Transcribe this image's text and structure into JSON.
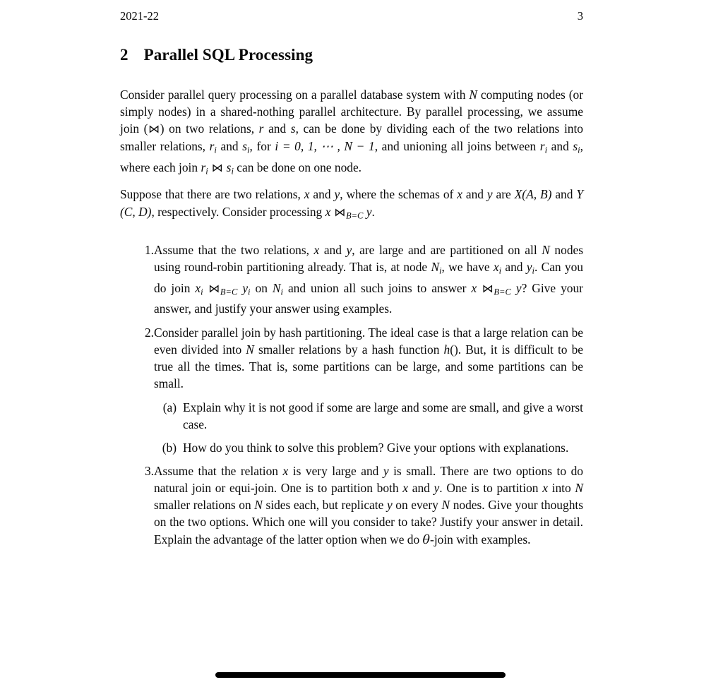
{
  "header": {
    "left": "2021-22",
    "page_number": "3"
  },
  "section": {
    "number": "2",
    "title": "Parallel SQL Processing"
  },
  "paragraphs": {
    "p1_part1": "Consider parallel query processing on a parallel database system with ",
    "p1_var_N1": "N",
    "p1_part2": " computing nodes (or simply nodes) in a shared-nothing parallel architecture. By parallel processing, we assume join (",
    "p1_bowtie1": "⋈",
    "p1_part3": ") on two relations, ",
    "p1_var_r1": "r",
    "p1_part4": " and ",
    "p1_var_s1": "s",
    "p1_part5": ", can be done by dividing each of the two relations into smaller relations, ",
    "p1_var_ri1": "r",
    "p1_sub_i1": "i",
    "p1_part6": " and ",
    "p1_var_si1": "s",
    "p1_sub_i2": "i",
    "p1_part7": ", for ",
    "p1_math_range": "i = 0, 1, ⋯ , N − 1",
    "p1_part8": ", and unioning all joins between ",
    "p1_var_ri2": "r",
    "p1_sub_i3": "i",
    "p1_part9": " and ",
    "p1_var_si2": "s",
    "p1_sub_i4": "i",
    "p1_part10": ", where each join ",
    "p1_var_ri3": "r",
    "p1_sub_i5": "i",
    "p1_bowtie2": "⋈",
    "p1_var_si3": "s",
    "p1_sub_i6": "i",
    "p1_part11": " can be done on one node.",
    "p2_part1": "Suppose that there are two relations, ",
    "p2_var_x1": "x",
    "p2_part2": " and ",
    "p2_var_y1": "y",
    "p2_part3": ", where the schemas of ",
    "p2_var_x2": "x",
    "p2_part4": " and ",
    "p2_var_y2": "y",
    "p2_part5": " are ",
    "p2_schema_X": "X(A, B)",
    "p2_part6": " and ",
    "p2_schema_Y": "Y (C, D)",
    "p2_part7": ", respectively. Consider processing ",
    "p2_var_x3": "x",
    "p2_bowtie": "⋈",
    "p2_sub_bc": "B=C",
    "p2_var_y3": "y",
    "p2_part8": "."
  },
  "items": {
    "item1": {
      "marker": "1.",
      "t1": "Assume that the two relations, ",
      "v_x1": "x",
      "t2": " and ",
      "v_y1": "y",
      "t3": ", are large and are partitioned on all ",
      "v_N1": "N",
      "t4": " nodes using round-robin partitioning already. That is, at node ",
      "v_N2": "N",
      "s_i1": "i",
      "t5": ", we have ",
      "v_x2": "x",
      "s_i2": "i",
      "t6": " and ",
      "v_y2": "y",
      "s_i3": "i",
      "t7": ". Can you do join ",
      "v_x3": "x",
      "s_i4": "i",
      "bowtie1": "⋈",
      "sub_bc1": "B=C",
      "v_y3": "y",
      "s_i5": "i",
      "t8": " on ",
      "v_N3": "N",
      "s_i6": "i",
      "t9": " and union all such joins to answer ",
      "v_x4": "x",
      "bowtie2": "⋈",
      "sub_bc2": "B=C",
      "v_y4": "y",
      "t10": "? Give your answer, and justify your answer using examples."
    },
    "item2": {
      "marker": "2.",
      "t1": "Consider parallel join by hash partitioning. The ideal case is that a large relation can be even divided into ",
      "v_N1": "N",
      "t2": " smaller relations by a hash function ",
      "v_h": "h",
      "t3": "(). But, it is difficult to be true all the times. That is, some partitions can be large, and some partitions can be small.",
      "sub": {
        "a": {
          "marker": "(a)",
          "text": "Explain why it is not good if some are large and some are small, and give a worst case."
        },
        "b": {
          "marker": "(b)",
          "text": "How do you think to solve this problem? Give your options with explanations."
        }
      }
    },
    "item3": {
      "marker": "3.",
      "t1": "Assume that the relation ",
      "v_x1": "x",
      "t2": " is very large and ",
      "v_y1": "y",
      "t3": " is small. There are two options to do natural join or equi-join. One is to partition both ",
      "v_x2": "x",
      "t4": " and ",
      "v_y2": "y",
      "t5": ". One is to partition ",
      "v_x3": "x",
      "t6": " into ",
      "v_N1": "N",
      "t7": " smaller relations on ",
      "v_N2": "N",
      "t8": " sides each, but replicate ",
      "v_y3": "y",
      "t9": " on every ",
      "v_N3": "N",
      "t10": " nodes. Give your thoughts on the two options. Which one will you consider to take? Justify your answer in detail. Explain the advantage of the latter option when we do ",
      "v_theta": "θ",
      "t11": "-join with examples."
    }
  },
  "colors": {
    "page_background": "#ffffff",
    "text": "#0a0a0a",
    "bottom_bar": "#000000"
  }
}
